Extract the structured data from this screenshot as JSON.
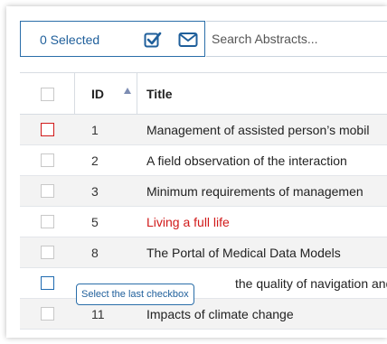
{
  "toolbar": {
    "selected_label": "0 Selected",
    "search_placeholder": "Search Abstracts..."
  },
  "table": {
    "columns": [
      "ID",
      "Title"
    ],
    "rows": [
      {
        "id": "1",
        "title": "Management of assisted person’s mobil"
      },
      {
        "id": "2",
        "title": "A field observation of the interaction"
      },
      {
        "id": "3",
        "title": "Minimum requirements of managemen"
      },
      {
        "id": "5",
        "title": "Living a full life"
      },
      {
        "id": "8",
        "title": "The Portal of Medical Data Models"
      },
      {
        "id": "",
        "title": "the quality of navigation and"
      },
      {
        "id": "11",
        "title": "Impacts of climate change"
      }
    ]
  },
  "tooltip": {
    "text": "Select the last checkbox"
  },
  "colors": {
    "accent_blue": "#1f5f9b",
    "highlight_red": "#d11a1a",
    "row_alt": "#f3f3f3"
  }
}
